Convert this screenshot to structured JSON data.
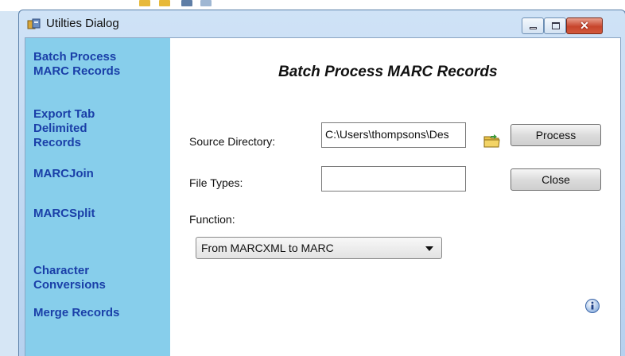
{
  "window": {
    "title": "Utilties Dialog",
    "close_glyph": "✕"
  },
  "sidebar": {
    "items": [
      {
        "label": "Batch Process\nMARC Records"
      },
      {
        "label": "Export Tab\nDelimited\nRecords"
      },
      {
        "label": "MARCJoin"
      },
      {
        "label": "MARCSplit"
      },
      {
        "label": "Character\nConversions"
      },
      {
        "label": "Merge Records"
      }
    ]
  },
  "main": {
    "heading": "Batch Process MARC Records",
    "source_directory": {
      "label": "Source Directory:",
      "value": "C:\\Users\\thompsons\\Des"
    },
    "file_types": {
      "label": "File Types:",
      "value": ""
    },
    "function": {
      "label": "Function:",
      "selected": "From MARCXML to MARC"
    },
    "buttons": {
      "process": "Process",
      "close": "Close"
    }
  },
  "colors": {
    "sidebar_bg": "#87ceeb",
    "link_color": "#1a3fa8",
    "close_button": "#c7452c"
  },
  "icons": {
    "title": "utilities-app-icon",
    "browse": "folder-icon",
    "info": "info-icon"
  }
}
